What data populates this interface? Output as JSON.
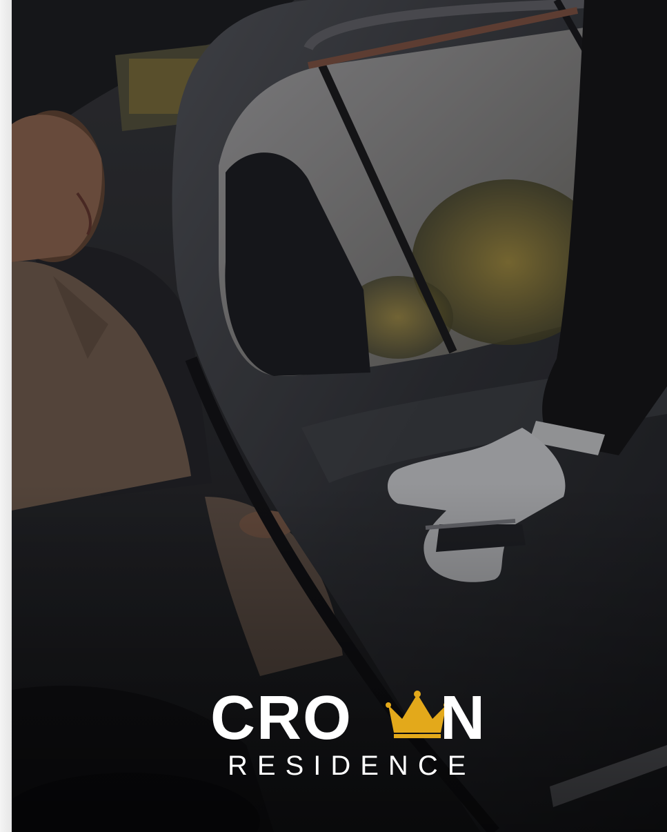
{
  "brand": {
    "word_part_a": "CRO",
    "word_part_b": "N",
    "subtitle": "RESIDENCE",
    "crown_color": "#e3a91b",
    "text_color": "#ffffff"
  },
  "photo": {
    "subject": "chauffeur-opening-car-door"
  }
}
